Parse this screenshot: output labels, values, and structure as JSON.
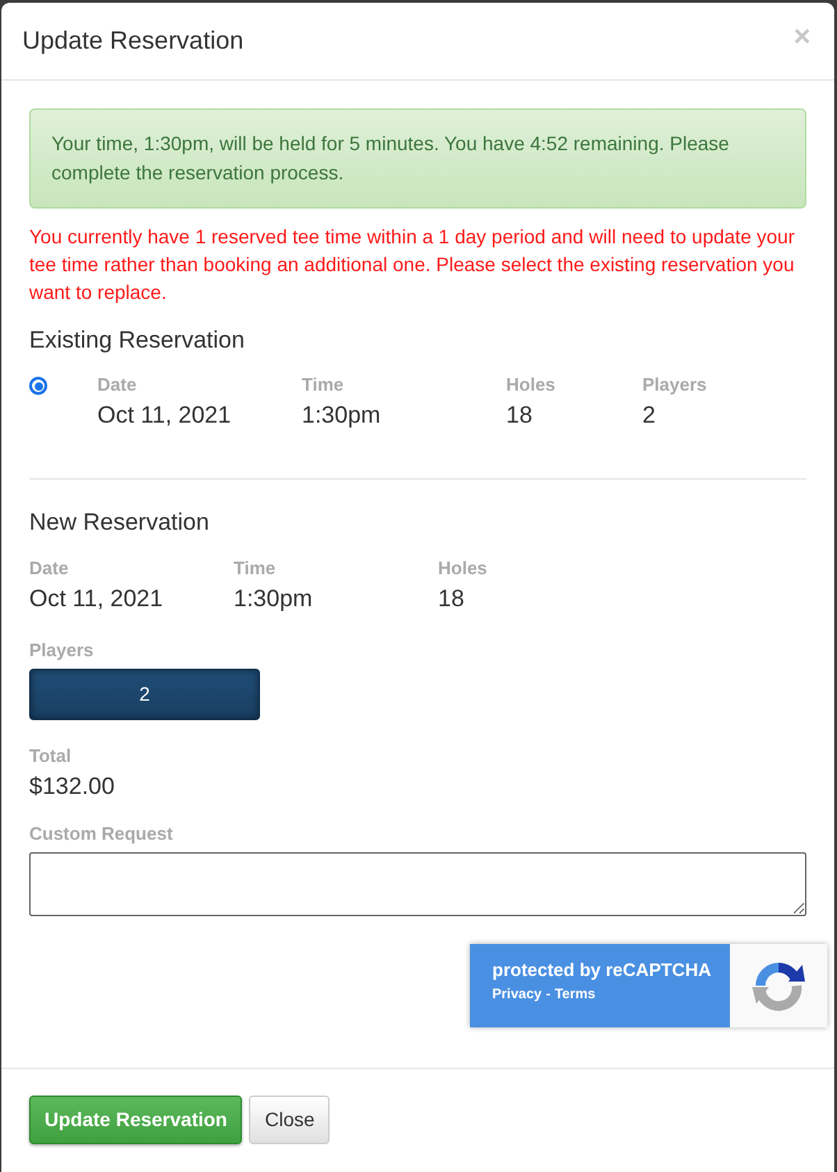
{
  "modal": {
    "title": "Update Reservation",
    "close_glyph": "×"
  },
  "alert": {
    "text": "Your time, 1:30pm, will be held for 5 minutes. You have 4:52 remaining. Please complete the reservation process."
  },
  "warning": "You currently have 1 reserved tee time within a 1 day period and will need to update your tee time rather than booking an additional one. Please select the existing reservation you want to replace.",
  "existing": {
    "heading": "Existing Reservation",
    "reservations": [
      {
        "selected": true,
        "fields": [
          {
            "label": "Date",
            "value": "Oct 11, 2021"
          },
          {
            "label": "Time",
            "value": "1:30pm"
          },
          {
            "label": "Holes",
            "value": "18"
          },
          {
            "label": "Players",
            "value": "2"
          }
        ]
      }
    ]
  },
  "new_reservation": {
    "heading": "New Reservation",
    "fields": [
      {
        "label": "Date",
        "value": "Oct 11, 2021"
      },
      {
        "label": "Time",
        "value": "1:30pm"
      },
      {
        "label": "Holes",
        "value": "18"
      }
    ],
    "players": {
      "label": "Players",
      "value": "2"
    },
    "total": {
      "label": "Total",
      "value": "$132.00"
    },
    "custom_request": {
      "label": "Custom Request"
    }
  },
  "recaptcha": {
    "text": "protected by reCAPTCHA",
    "links": [
      "Privacy",
      "Terms"
    ],
    "separator": "-"
  },
  "buttons": [
    {
      "label": "Update Reservation",
      "kind": "primary"
    },
    {
      "label": "Close",
      "kind": "default"
    }
  ]
}
